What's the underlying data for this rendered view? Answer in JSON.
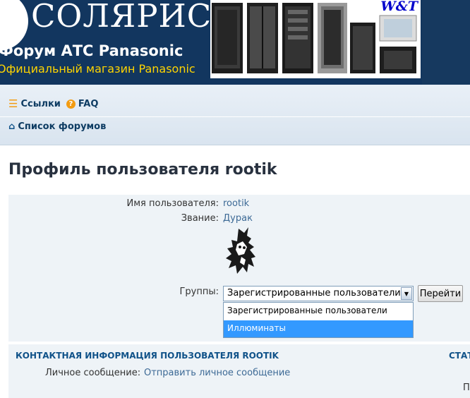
{
  "header": {
    "logo_text": "СОЛЯРИС",
    "forum_title": "Форум АТС Panasonic",
    "shop_title": "Официальный магазин Panasonic",
    "banner_brand": "W&T"
  },
  "nav": {
    "links_label": "Ссылки",
    "faq_label": "FAQ",
    "forum_list_label": "Список форумов"
  },
  "page_title": "Профиль пользователя rootik",
  "profile": {
    "username_label": "Имя пользователя:",
    "username_value": "rootik",
    "rank_label": "Звание:",
    "rank_value": "Дурак",
    "groups_label": "Группы:",
    "groups_selected": "Зарегистрированные пользователи",
    "go_button": "Перейти",
    "groups_options": [
      "Зарегистрированные пользователи",
      "Иллюминаты"
    ]
  },
  "contact": {
    "header": "КОНТАКТНАЯ ИНФОРМАЦИЯ ПОЛЬЗОВАТЕЛЯ ROOTIK",
    "stat_header_cut": "СТАТ",
    "pm_label": "Личное сообщение:",
    "pm_link": "Отправить личное сообщение",
    "cut_letter": "П"
  },
  "colors": {
    "header_bg": "#12365f",
    "shop_title": "#ffd400",
    "nav_text": "#0e3c63",
    "link": "#3d6a96",
    "selection": "#3399ff"
  }
}
